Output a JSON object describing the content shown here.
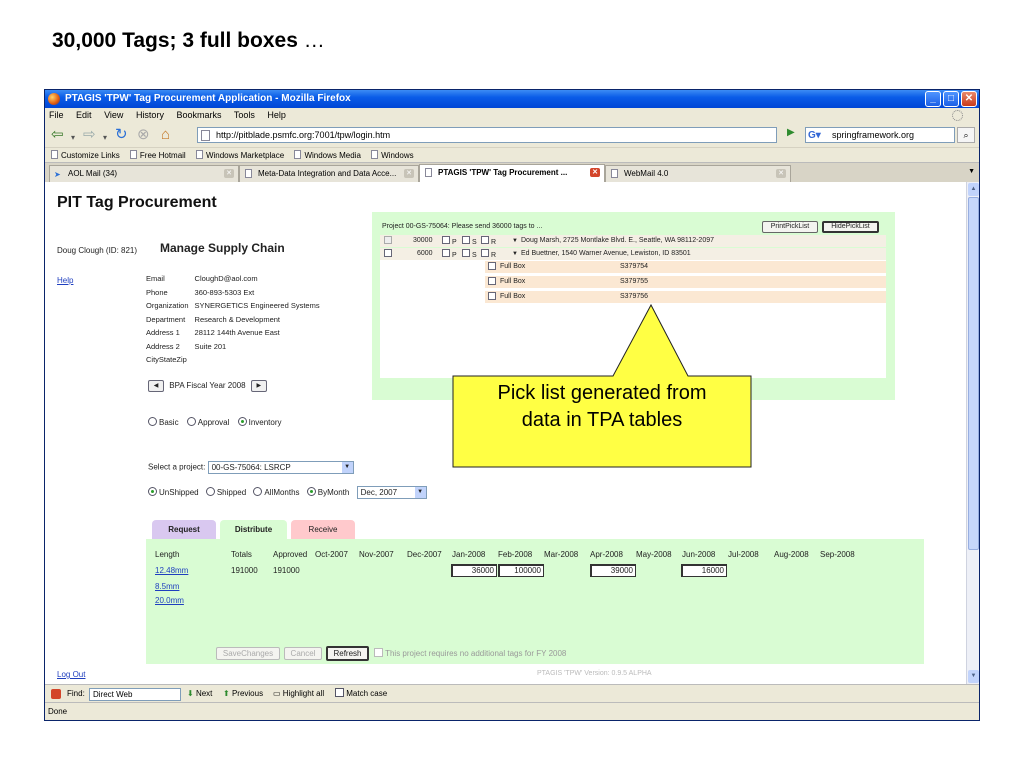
{
  "slide": {
    "title": "30,000 Tags; 3 full boxes",
    "title_ellipsis": "…"
  },
  "window": {
    "title": "PTAGIS 'TPW' Tag Procurement Application - Mozilla Firefox"
  },
  "menu": [
    "File",
    "Edit",
    "View",
    "History",
    "Bookmarks",
    "Tools",
    "Help"
  ],
  "nav": {
    "url": "http://pitblade.psmfc.org:7001/tpw/login.htm",
    "search": "springframework.org"
  },
  "bookmarks": [
    "Customize Links",
    "Free Hotmail",
    "Windows Marketplace",
    "Windows Media",
    "Windows"
  ],
  "tabs": [
    {
      "label": "AOL Mail (34)"
    },
    {
      "label": "Meta-Data Integration and Data Acce..."
    },
    {
      "label": "PTAGIS 'TPW' Tag Procurement ..."
    },
    {
      "label": "WebMail 4.0"
    }
  ],
  "app": {
    "title": "PIT Tag Procurement",
    "user": "Doug Clough (ID: 821)",
    "help": "Help",
    "section_title": "Manage Supply Chain",
    "info": [
      {
        "label": "Email",
        "value": "CloughD@aol.com"
      },
      {
        "label": "Phone",
        "value": "360-893-5303 Ext"
      },
      {
        "label": "Organization",
        "value": "SYNERGETICS Engineered Systems"
      },
      {
        "label": "Department",
        "value": "Research & Development"
      },
      {
        "label": "Address 1",
        "value": "28112 144th Avenue East"
      },
      {
        "label": "Address 2",
        "value": "Suite 201"
      },
      {
        "label": "CityStateZip",
        "value": ""
      }
    ],
    "fiscal_year": "BPA Fiscal Year 2008",
    "modes": {
      "basic": "Basic",
      "approval": "Approval",
      "inventory": "Inventory"
    },
    "select_project_label": "Select a project:",
    "project_value": "00-GS-75064: LSRCP",
    "shipping": {
      "unshipped": "UnShipped",
      "shipped": "Shipped",
      "allmonths": "AllMonths",
      "bymonth": "ByMonth",
      "month_value": "Dec, 2007"
    },
    "panel_tabs": {
      "request": "Request",
      "distribute": "Distribute",
      "receive": "Receive"
    },
    "distribute": {
      "headers": [
        "Length",
        "Totals",
        "Approved",
        "Oct-2007",
        "Nov-2007",
        "Dec-2007",
        "Jan-2008",
        "Feb-2008",
        "Mar-2008",
        "Apr-2008",
        "May-2008",
        "Jun-2008",
        "Jul-2008",
        "Aug-2008",
        "Sep-2008"
      ],
      "lengths": [
        "12.48mm",
        "8.5mm",
        "20.0mm"
      ],
      "totals": "191000",
      "approved": "191000",
      "dec": "36000",
      "jan": "100000",
      "mar": "39000",
      "may": "16000",
      "save_btn": "SaveChanges",
      "cancel_btn": "Cancel",
      "refresh_btn": "Refresh",
      "note": "This project requires no additional tags for FY 2008"
    },
    "picklist": {
      "header": "Project 00-GS-75064: Please send 36000 tags to ...",
      "print_btn": "PrintPickList",
      "hide_btn": "HidePickList",
      "rows": [
        {
          "qty": "30000",
          "address": "Doug Marsh, 2725 Montlake Blvd. E., Seattle, WA 98112-2097"
        },
        {
          "qty": "6000",
          "address": "Ed Buettner, 1540 Warner Avenue, Lewiston, ID 83501"
        }
      ],
      "flags": [
        "P",
        "S",
        "R"
      ],
      "boxes": [
        {
          "label": "Full Box",
          "serial": "S379754"
        },
        {
          "label": "Full Box",
          "serial": "S379755"
        },
        {
          "label": "Full Box",
          "serial": "S379756"
        }
      ]
    },
    "logout": "Log Out",
    "version": "PTAGIS 'TPW' Version: 0.9.5 ALPHA"
  },
  "findbar": {
    "label": "Find:",
    "value": "Direct Web",
    "next": "Next",
    "previous": "Previous",
    "highlight": "Highlight all",
    "matchcase": "Match case"
  },
  "status": "Done",
  "callout": {
    "line1": "Pick list generated from",
    "line2": "data in TPA tables",
    "fill": "#ffff44"
  }
}
